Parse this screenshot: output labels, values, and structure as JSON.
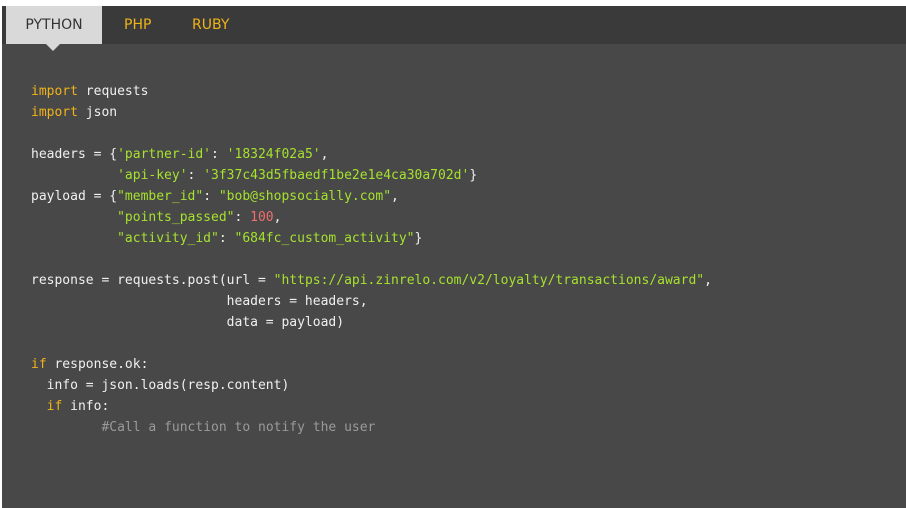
{
  "tabs": [
    {
      "label": "PYTHON",
      "active": true
    },
    {
      "label": "PHP",
      "active": false
    },
    {
      "label": "RUBY",
      "active": false
    }
  ],
  "code": {
    "lines": [
      [
        {
          "t": "kw",
          "v": "import"
        },
        {
          "t": "plain",
          "v": " requests"
        }
      ],
      [
        {
          "t": "kw",
          "v": "import"
        },
        {
          "t": "plain",
          "v": " json"
        }
      ],
      [],
      [
        {
          "t": "plain",
          "v": "headers = {"
        },
        {
          "t": "str",
          "v": "'partner-id'"
        },
        {
          "t": "plain",
          "v": ": "
        },
        {
          "t": "str",
          "v": "'18324f02a5'"
        },
        {
          "t": "plain",
          "v": ","
        }
      ],
      [
        {
          "t": "plain",
          "v": "           "
        },
        {
          "t": "str",
          "v": "'api-key'"
        },
        {
          "t": "plain",
          "v": ": "
        },
        {
          "t": "str",
          "v": "'3f37c43d5fbaedf1be2e1e4ca30a702d'"
        },
        {
          "t": "plain",
          "v": "}"
        }
      ],
      [
        {
          "t": "plain",
          "v": "payload = {"
        },
        {
          "t": "str",
          "v": "\"member_id\""
        },
        {
          "t": "plain",
          "v": ": "
        },
        {
          "t": "str",
          "v": "\"bob@shopsocially.com\""
        },
        {
          "t": "plain",
          "v": ","
        }
      ],
      [
        {
          "t": "plain",
          "v": "           "
        },
        {
          "t": "str",
          "v": "\"points_passed\""
        },
        {
          "t": "plain",
          "v": ": "
        },
        {
          "t": "num",
          "v": "100"
        },
        {
          "t": "plain",
          "v": ","
        }
      ],
      [
        {
          "t": "plain",
          "v": "           "
        },
        {
          "t": "str",
          "v": "\"activity_id\""
        },
        {
          "t": "plain",
          "v": ": "
        },
        {
          "t": "str",
          "v": "\"684fc_custom_activity\""
        },
        {
          "t": "plain",
          "v": "}"
        }
      ],
      [],
      [
        {
          "t": "plain",
          "v": "response = requests.post(url = "
        },
        {
          "t": "str",
          "v": "\"https://api.zinrelo.com/v2/loyalty/transactions/award\""
        },
        {
          "t": "plain",
          "v": ","
        }
      ],
      [
        {
          "t": "plain",
          "v": "                         headers = headers,"
        }
      ],
      [
        {
          "t": "plain",
          "v": "                         data = payload)"
        }
      ],
      [],
      [
        {
          "t": "kw",
          "v": "if"
        },
        {
          "t": "plain",
          "v": " response.ok:"
        }
      ],
      [
        {
          "t": "plain",
          "v": "  info = json.loads(resp.content)"
        }
      ],
      [
        {
          "t": "plain",
          "v": "  "
        },
        {
          "t": "kw",
          "v": "if"
        },
        {
          "t": "plain",
          "v": " info:"
        }
      ],
      [
        {
          "t": "plain",
          "v": "         "
        },
        {
          "t": "cm",
          "v": "#Call a function to notify the user"
        }
      ]
    ]
  }
}
